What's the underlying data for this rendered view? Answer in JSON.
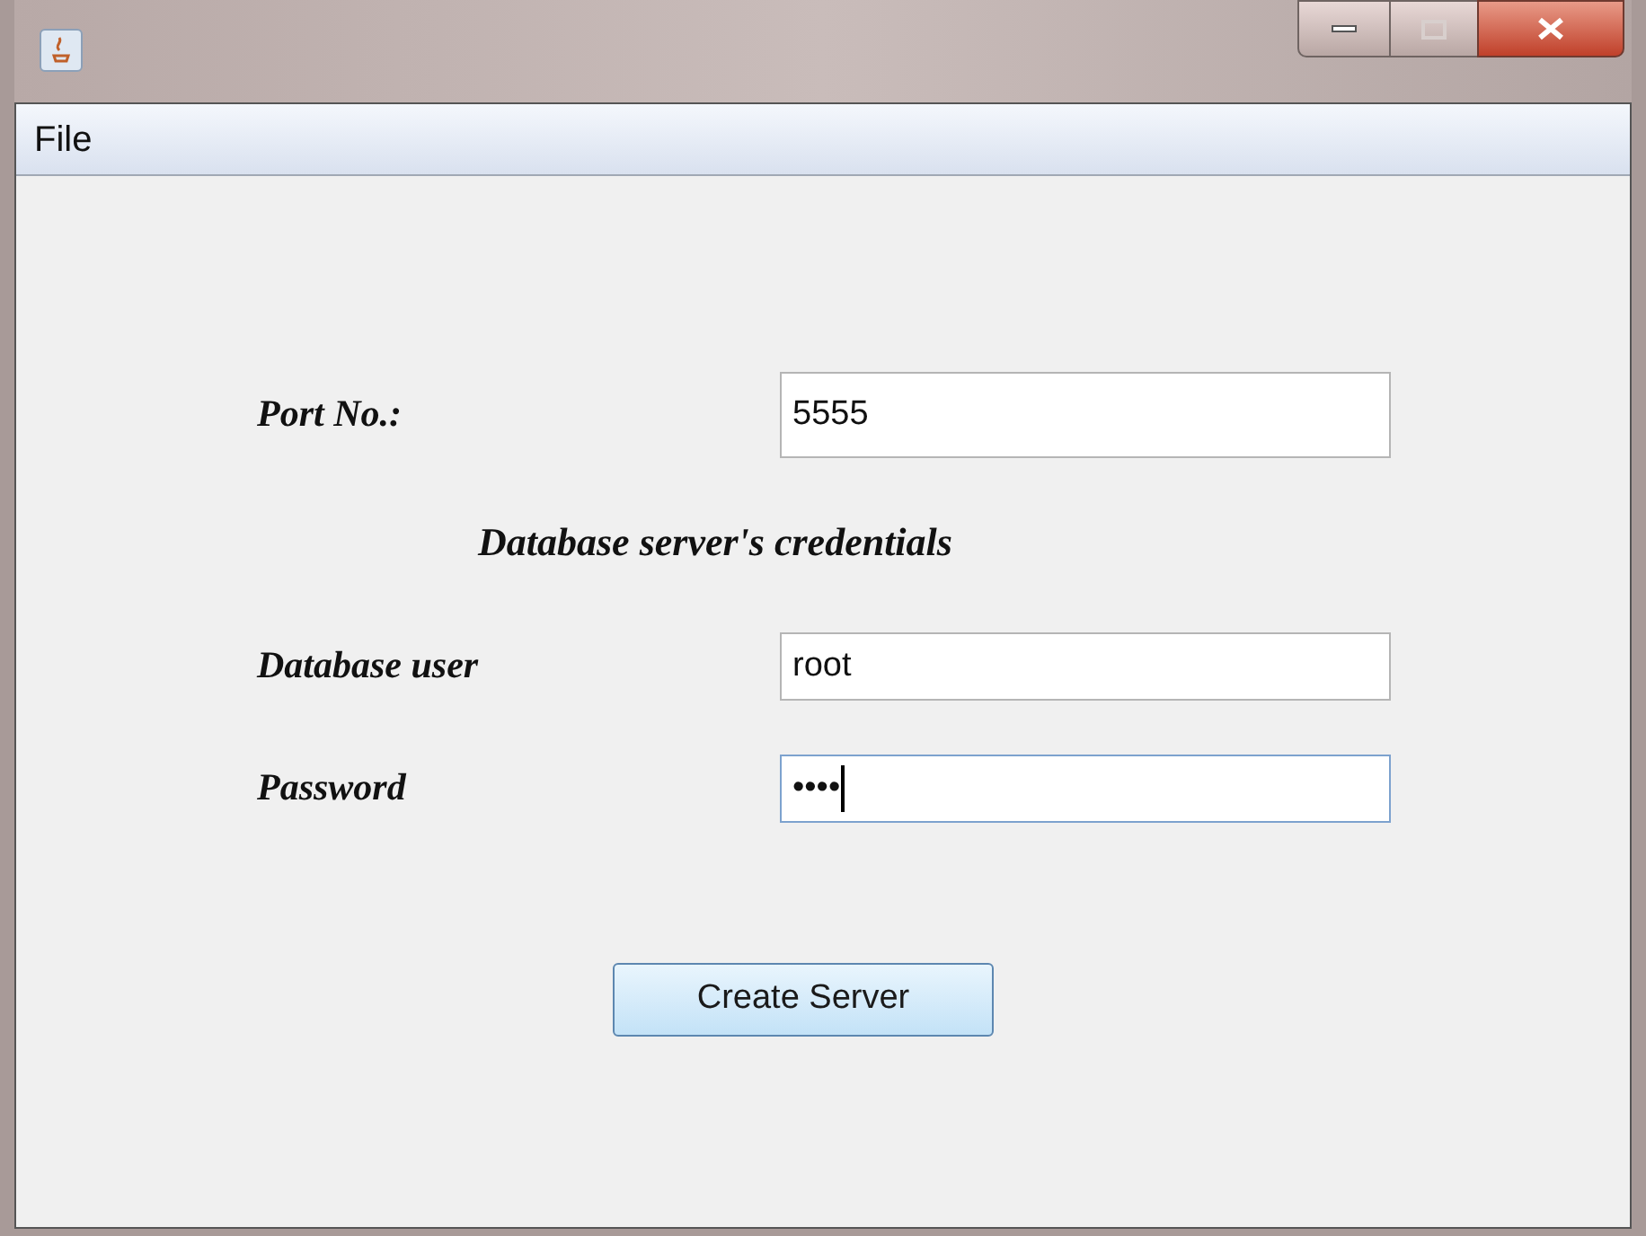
{
  "menu_bar": {
    "items": [
      {
        "label": "File"
      }
    ]
  },
  "form": {
    "port": {
      "label": "Port No.:",
      "value": "5555"
    },
    "heading": "Database server's credentials",
    "user": {
      "label": "Database user",
      "value": "root"
    },
    "password": {
      "label": "Password",
      "value": "••••",
      "focused": true
    },
    "button": "Create Server"
  }
}
